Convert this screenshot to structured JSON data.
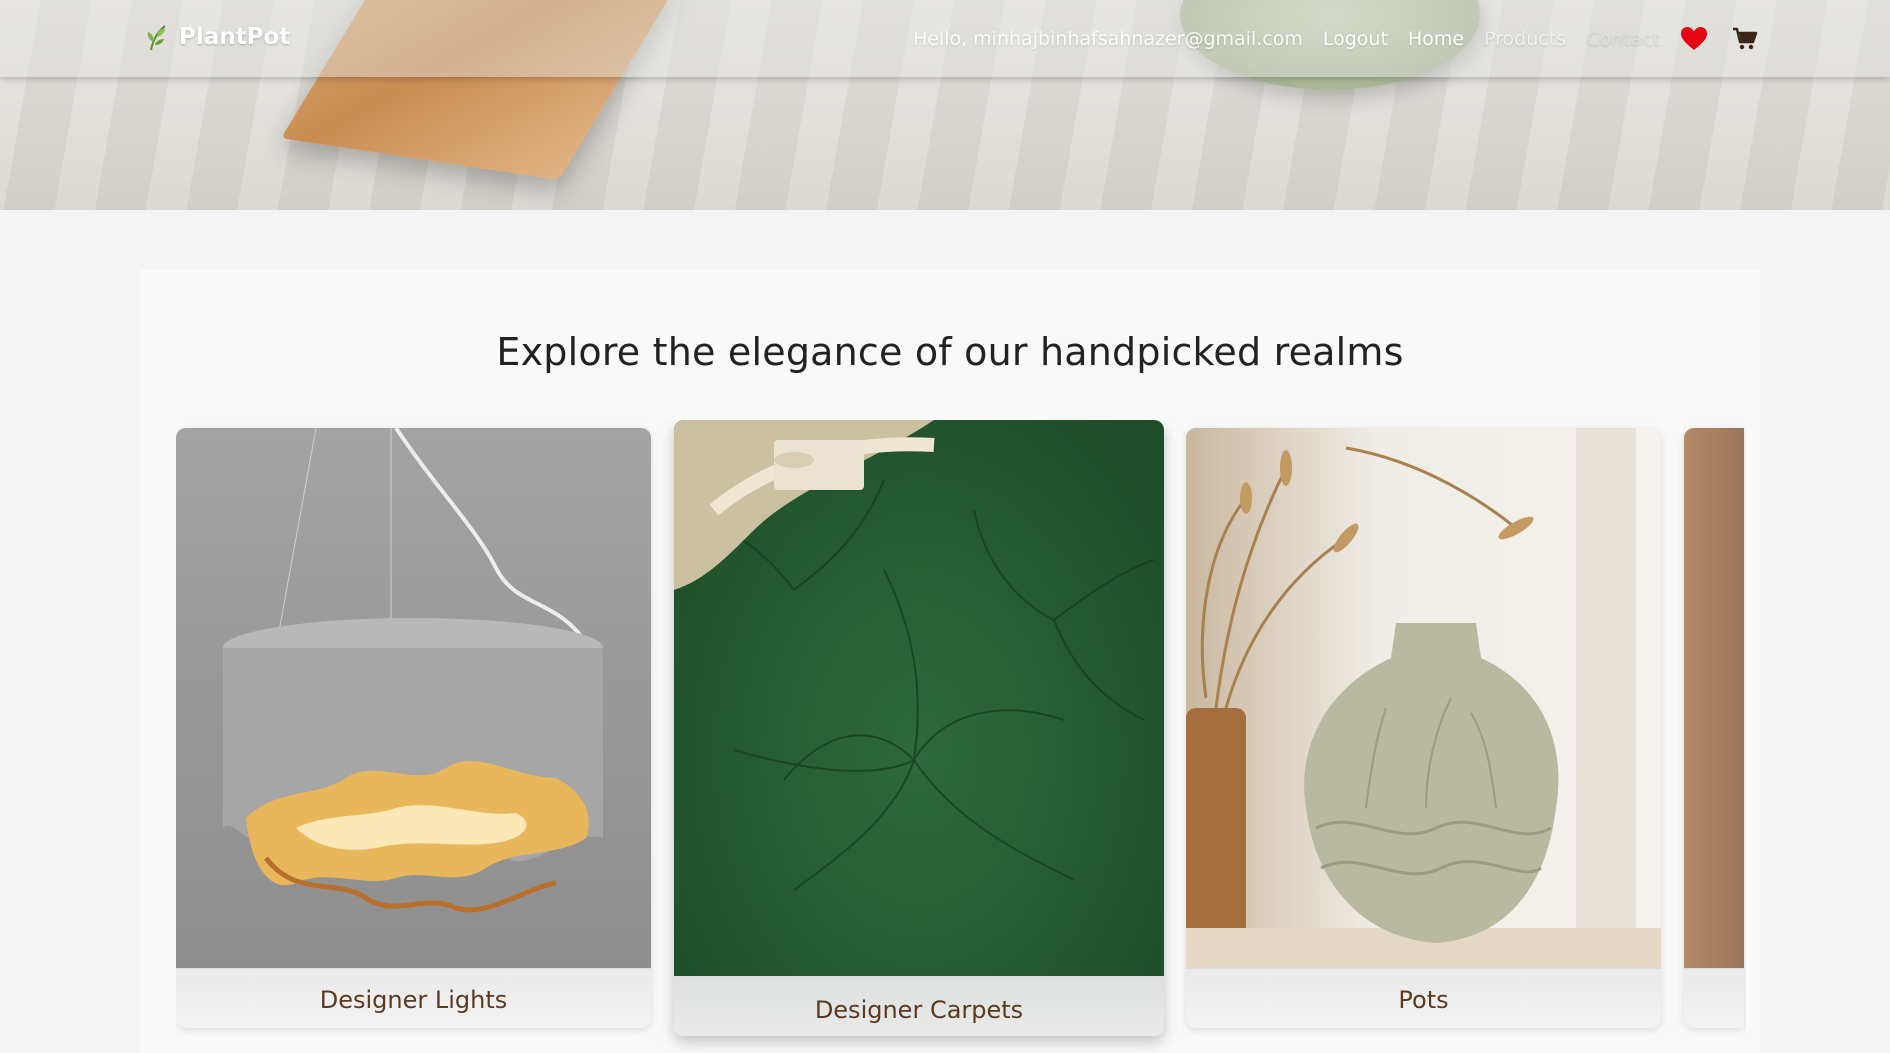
{
  "brand": {
    "name": "PlantPot",
    "logo_icon": "leaf-icon"
  },
  "nav": {
    "greeting": "Hello, minhajbinhafsahnazer@gmail.com",
    "logout": "Logout",
    "home": "Home",
    "products": "Products",
    "contact": "Contact",
    "wishlist_icon": "heart-icon",
    "cart_icon": "cart-icon"
  },
  "colors": {
    "heart": "#e30613",
    "caption_text": "#5b3a1e",
    "title_text": "#222222"
  },
  "section": {
    "title": "Explore the elegance of our handpicked realms"
  },
  "categories": [
    {
      "label": "Designer Lights"
    },
    {
      "label": "Designer Carpets"
    },
    {
      "label": "Pots"
    },
    {
      "label": ""
    }
  ]
}
